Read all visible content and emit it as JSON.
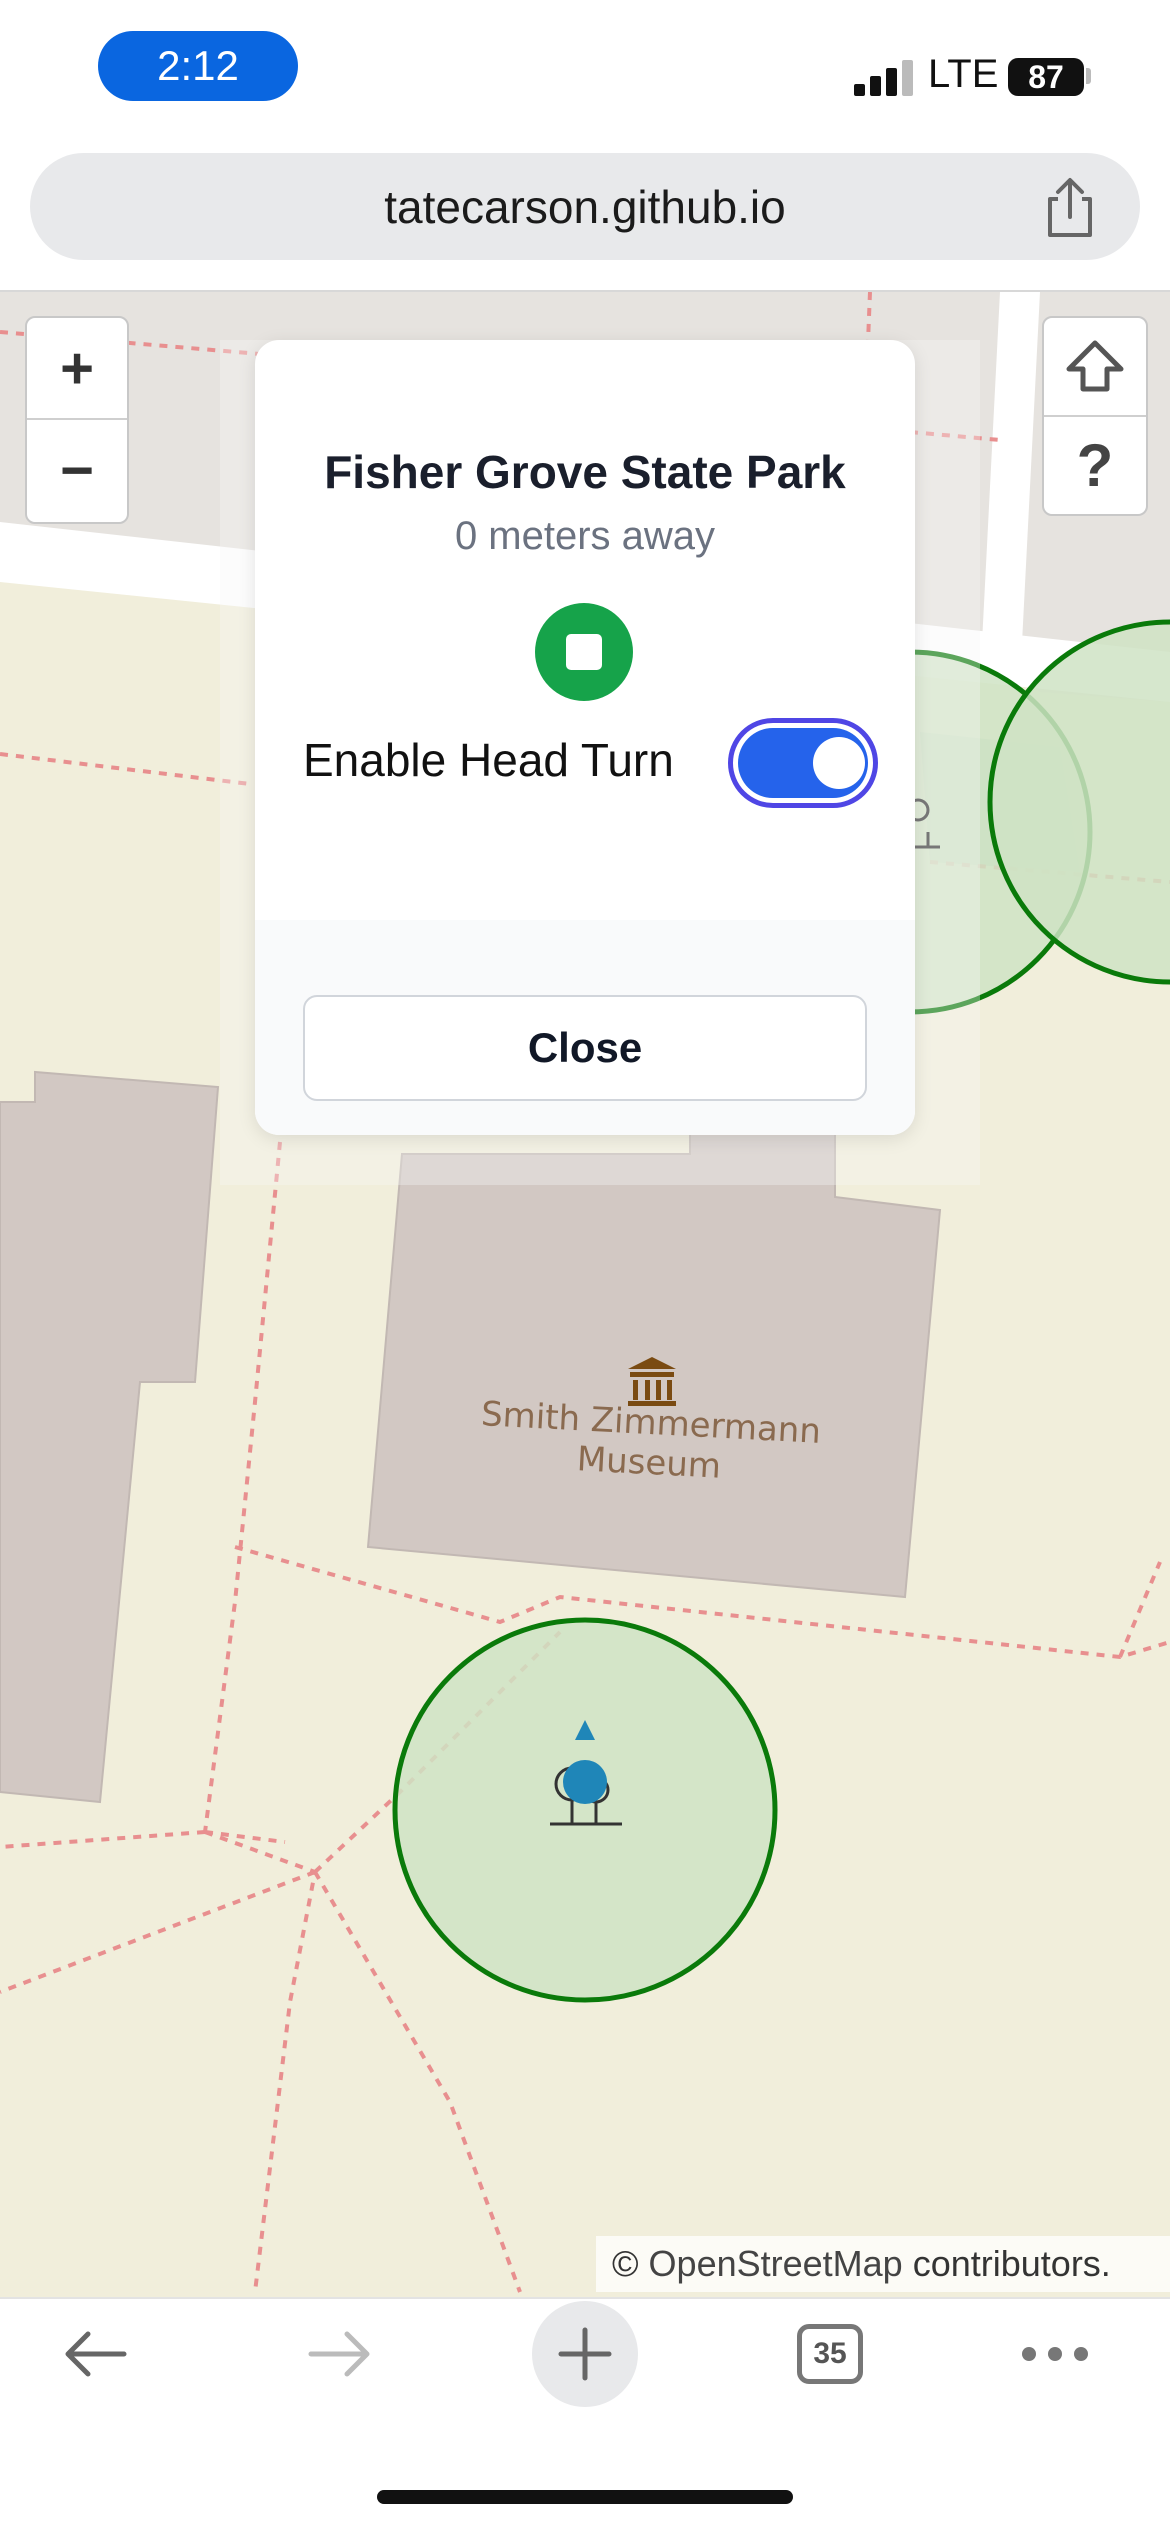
{
  "status_bar": {
    "time": "2:12",
    "network": "LTE",
    "battery": "87"
  },
  "browser": {
    "url": "tatecarson.github.io",
    "tab_count": "35"
  },
  "map": {
    "zoom_in_label": "+",
    "zoom_out_label": "−",
    "help_label": "?",
    "museum_label_line1": "Smith Zimmermann",
    "museum_label_line2": "Museum",
    "attribution_symbol": "©",
    "attribution_link": "OpenStreetMap",
    "attribution_suffix": "contributors."
  },
  "modal": {
    "title": "Fisher Grove State Park",
    "distance": "0 meters away",
    "toggle_label": "Enable Head Turn",
    "toggle_on": true,
    "close_label": "Close"
  },
  "colors": {
    "accent": "#2563eb",
    "stop_green": "#16a34a",
    "zone_stroke": "#0a7a0a",
    "zone_fill": "#cfe3c4",
    "land": "#f1eedb",
    "building": "#d2c8c3"
  }
}
